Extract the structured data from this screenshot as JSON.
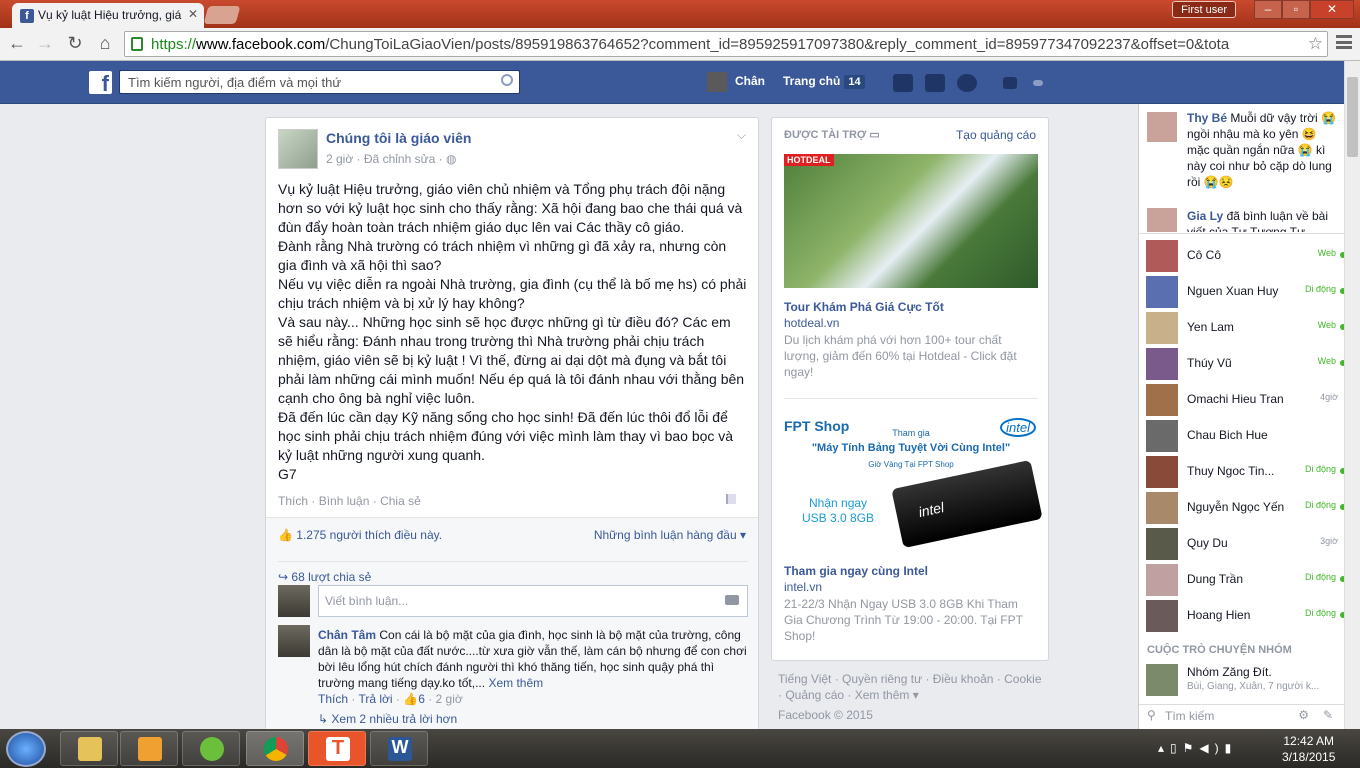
{
  "browser": {
    "tab_title": "Vụ kỷ luật Hiệu trưởng, giá",
    "user_badge": "First user",
    "url_scheme": "https://",
    "url_host": "www.facebook.com",
    "url_path": "/ChungToiLaGiaoVien/posts/895919863764652?comment_id=895925917097380&reply_comment_id=895977347092237&offset=0&tota"
  },
  "fb_header": {
    "search_placeholder": "Tìm kiếm người, địa điểm và mọi thứ",
    "user_name": "Chân",
    "home_label": "Trang chủ",
    "home_count": "14"
  },
  "post": {
    "page_name": "Chúng tôi là giáo viên",
    "time": "2 giờ",
    "edited": "Đã chỉnh sửa",
    "text": "Vụ kỷ luật Hiệu trưởng, giáo viên chủ nhiệm và Tổng phụ trách đội nặng\nhơn so với kỷ luật học sinh cho thấy rằng: Xã hội đang bao che thái quá và\nđùn đẩy hoàn toàn trách nhiệm giáo dục lên vai Các thầy cô giáo.\nĐành rằng Nhà trường có trách nhiệm vì những gì đã xảy ra, nhưng còn\ngia đình và xã hội thì sao?\nNếu vụ việc diễn ra ngoài Nhà trường, gia đình (cụ thể là bố mẹ hs) có phải\nchịu trách nhiệm và bị xử lý hay không?\nVà sau này... Những học sinh sẽ học được những gì từ điều đó? Các em\nsẽ hiểu rằng: Đánh nhau trong trường thì Nhà trường phải chịu trách\nnhiệm, giáo viên sẽ bị kỷ luật ! Vì thế, đừng ai dại dột mà đụng và bắt tôi\nphải làm những cái mình muốn! Nếu ép quá là tôi đánh nhau với thằng bên\ncạnh cho ông bà nghỉ việc luôn.\nĐã đến lúc cần dạy Kỹ năng sống cho học sinh! Đã đến lúc thôi đổ lỗi để\nhọc sinh phải chịu trách nhiệm đúng với việc mình làm thay vì bao bọc và\nkỷ luật những người xung quanh.\nG7",
    "action_like": "Thích",
    "action_comment": "Bình luận",
    "action_share": "Chia sẻ",
    "likes": "1.275 người thích điều này.",
    "top_comments": "Những bình luận hàng đầu",
    "shares": "68 lượt chia sẻ",
    "comment_placeholder": "Viết bình luận...",
    "comment_author": "Chân Tâm",
    "comment_text": "Con cái là bộ mặt của gia đình, học sinh là bộ mặt của trường, công dân là bộ mặt của đất nước....từ xưa giờ vẫn thế, làm cán bộ nhưng để con chơi bời lêu lổng hút chích đánh người thì khó thăng tiến, học sinh quậy phá thì trường mang tiếng dạy.ko tốt,...",
    "see_more": "Xem thêm",
    "comment_like": "Thích",
    "comment_reply": "Trả lời",
    "comment_likes": "6",
    "comment_time": "2 giờ",
    "more_replies": "Xem 2 nhiều trả lời hơn"
  },
  "sponsored": {
    "header": "ĐƯỢC TÀI TRỢ",
    "create_ad": "Tạo quảng cáo",
    "ad1_badge": "HOTDEAL",
    "ad1_title": "Tour Khám Phá Giá Cực Tốt",
    "ad1_host": "hotdeal.vn",
    "ad1_body": "Du lịch khám phá với hơn 100+ tour chất lượng, giảm đến 60% tại Hotdeal - Click đặt ngay!",
    "ad2_brand": "FPT Shop",
    "ad2_partner": "intel",
    "ad2_join": "Tham gia",
    "ad2_slogan": "\"Máy Tính Bảng Tuyệt Vời Cùng Intel\"",
    "ad2_sub": "Giờ Vàng Tại FPT Shop",
    "ad2_receive": "Nhận ngay\nUSB 3.0 8GB",
    "ad2_usb": "intel",
    "ad2_title": "Tham gia ngay cùng Intel",
    "ad2_host": "intel.vn",
    "ad2_body": "21-22/3 Nhận Ngay USB 3.0 8GB Khi Tham Gia Chương Trình Từ 19:00 - 20:00. Tại FPT Shop!"
  },
  "footer": {
    "line1": "Tiếng Việt · Quyền riêng tư · Điều khoản · Cookie · Quảng cáo · Xem thêm ▾",
    "copyright": "Facebook © 2015"
  },
  "ticker": [
    {
      "name": "Thy Bé",
      "text": "Muỗi dữ vậy trời 😭 ngồi nhậu mà ko yên 😆 mặc quần ngắn nữa 😭 kì này coi như bỏ cặp dò lung rồi 😭😣"
    },
    {
      "name": "Gia Ly",
      "text": "đã bình luận về bài viết của Tư Tượng Tư"
    }
  ],
  "chat": [
    {
      "name": "Cô Cô",
      "status": "Web",
      "dot": true
    },
    {
      "name": "Nguen Xuan Huy",
      "status": "Di động",
      "dot": true
    },
    {
      "name": "Yen Lam",
      "status": "Web",
      "dot": true
    },
    {
      "name": "Thúy Vũ",
      "status": "Web",
      "dot": true
    },
    {
      "name": "Omachi Hieu Tran",
      "status": "4giờ",
      "dot": false
    },
    {
      "name": "Chau Bich Hue",
      "status": "",
      "dot": false
    },
    {
      "name": "Thuy Ngoc Tin...",
      "status": "Di động",
      "dot": true
    },
    {
      "name": "Nguyễn Ngọc Yến",
      "status": "Di động",
      "dot": true
    },
    {
      "name": "Quy Du",
      "status": "3giờ",
      "dot": false
    },
    {
      "name": "Dung Trần",
      "status": "Di động",
      "dot": true
    },
    {
      "name": "Hoang Hien",
      "status": "Di động",
      "dot": true
    }
  ],
  "chat_group_header": "CUỘC TRÒ CHUYỆN NHÓM",
  "group": {
    "name": "Nhóm Zăng Đít.",
    "members": "Bùi, Giang, Xuân, 7 người k..."
  },
  "chat_search": "Tìm kiếm",
  "clock": {
    "time": "12:42 AM",
    "date": "3/18/2015"
  }
}
